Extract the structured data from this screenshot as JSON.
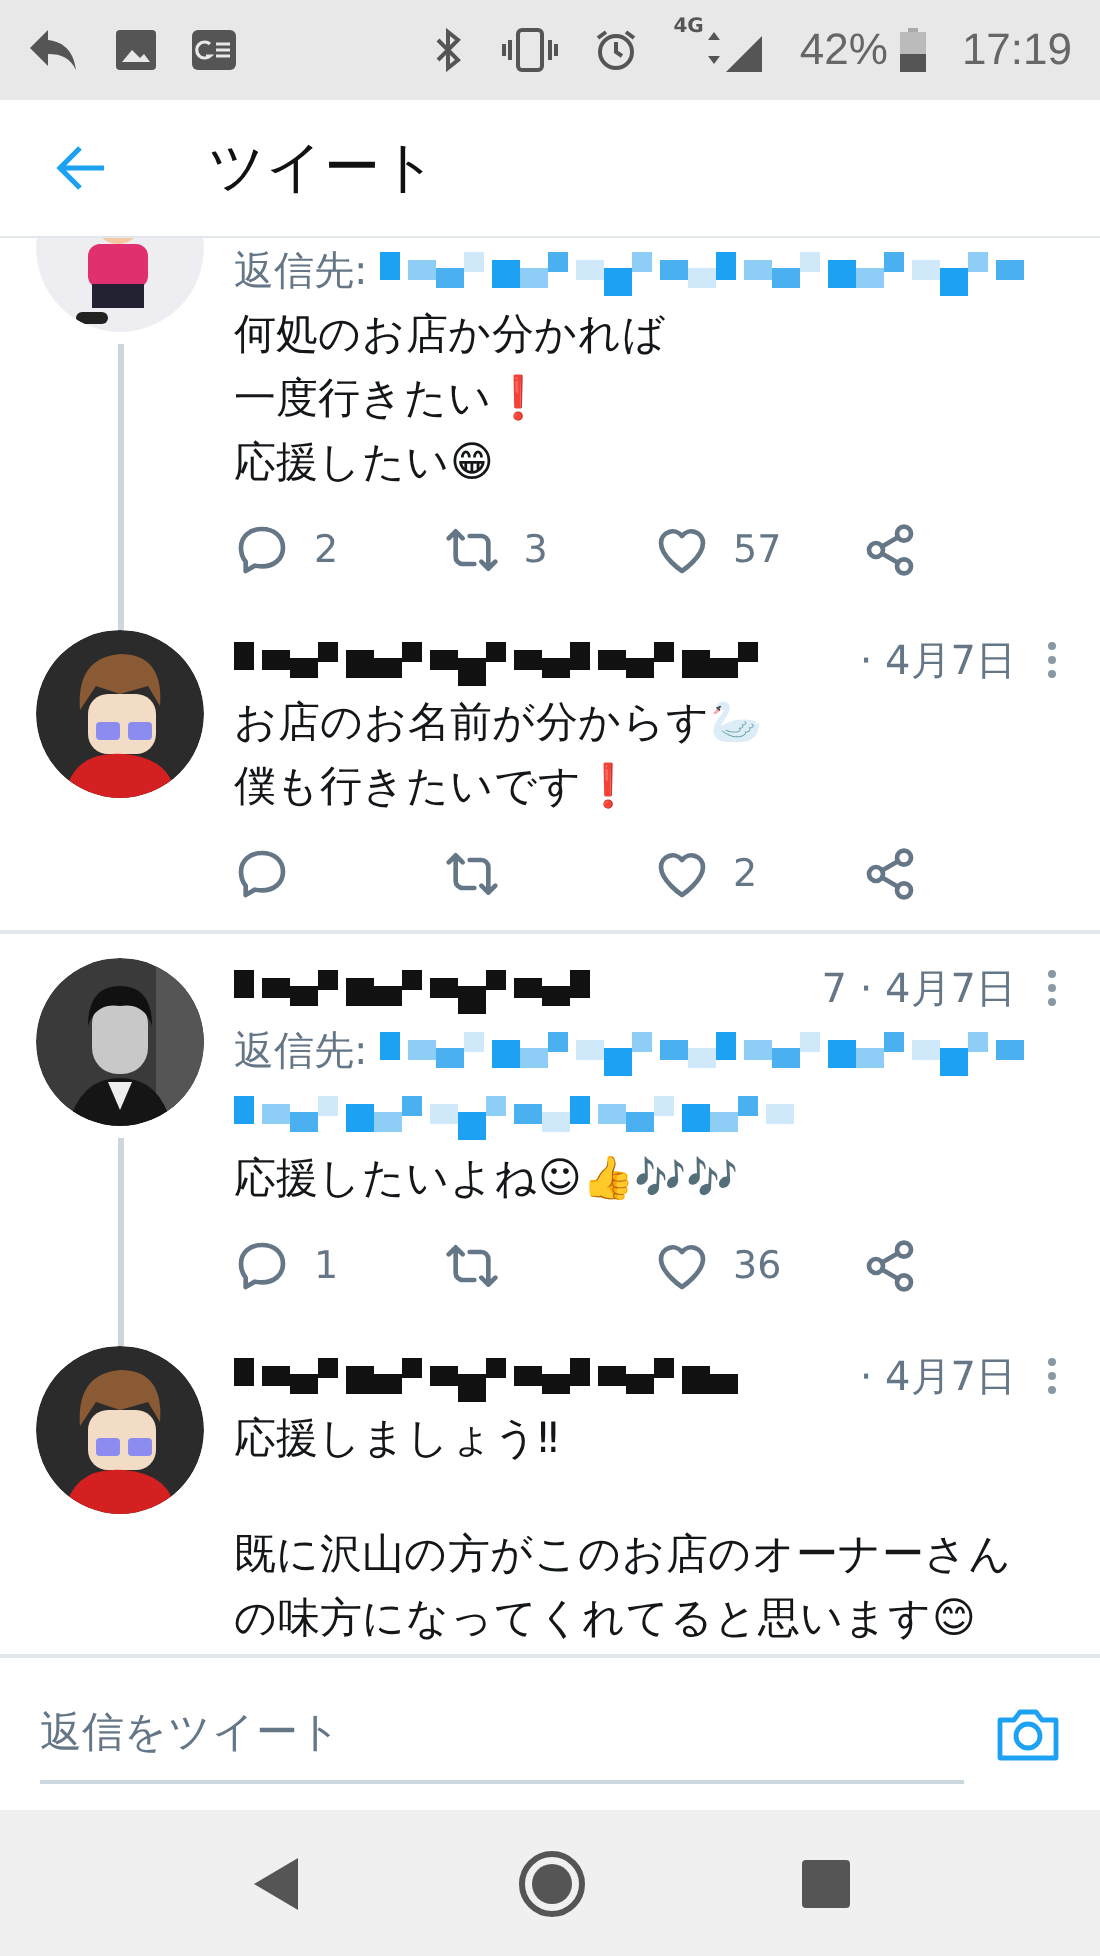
{
  "status_bar": {
    "network": "4G",
    "battery": "42%",
    "time": "17:19"
  },
  "header": {
    "title": "ツイート"
  },
  "tweets": [
    {
      "cut": true,
      "reply_to": {
        "label": "返信先:",
        "rows": [
          {
            "kind": "redacted"
          }
        ]
      },
      "paragraphs": [
        [
          "何処のお店か分かれば",
          "一度行きたい❗",
          "応援したい😁"
        ]
      ],
      "actions": [
        {
          "kind": "reply",
          "count": "2"
        },
        {
          "kind": "retweet",
          "count": "3"
        },
        {
          "kind": "like",
          "count": "57"
        },
        {
          "kind": "share"
        }
      ],
      "thread_below": true,
      "divider": false
    },
    {
      "cut": false,
      "date": "· 4月7日",
      "paragraphs": [
        [
          "お店のお名前が分からす🦢",
          "僕も行きたいです❗"
        ]
      ],
      "actions": [
        {
          "kind": "reply"
        },
        {
          "kind": "retweet"
        },
        {
          "kind": "like",
          "count": "2"
        },
        {
          "kind": "share"
        }
      ],
      "thread_below": false,
      "divider": true
    },
    {
      "cut": false,
      "date": "7 · 4月7日",
      "reply_to": {
        "label": "返信先:",
        "rows": [
          {
            "kind": "redacted"
          },
          {
            "kind": "redacted"
          }
        ]
      },
      "paragraphs": [
        [
          "応援したいよね☺👍🎶🎶"
        ]
      ],
      "actions": [
        {
          "kind": "reply",
          "count": "1"
        },
        {
          "kind": "retweet"
        },
        {
          "kind": "like",
          "count": "36"
        },
        {
          "kind": "share"
        }
      ],
      "thread_below": true,
      "divider": false
    },
    {
      "cut": false,
      "date": "· 4月7日",
      "paragraphs": [
        [
          "応援しましょう‼"
        ],
        [
          "既に沢山の方がこのお店のオーナーさん",
          "の味方になってくれてると思います😊"
        ]
      ],
      "thread_below": false,
      "divider": false
    }
  ],
  "reply_bar": {
    "placeholder": "返信をツイート"
  }
}
